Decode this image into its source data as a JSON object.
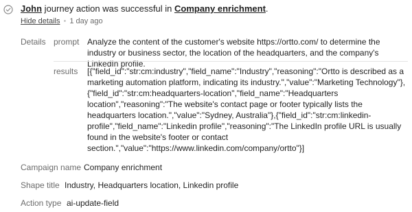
{
  "event": {
    "actor": "John",
    "message_mid": " journey action was successful in ",
    "journey": "Company enrichment",
    "message_end": ".",
    "hide_details": "Hide details",
    "time": "1 day ago"
  },
  "details": {
    "section_label": "Details",
    "prompt_label": "prompt",
    "prompt": "Analyze the content of the customer's website https://ortto.com/ to determine the industry or business sector, the location of the headquarters, and the company's LinkedIn profile.",
    "results_label": "results",
    "results": "[{\"field_id\":\"str:cm:industry\",\"field_name\":\"Industry\",\"reasoning\":\"Ortto is described as a marketing automation platform, indicating its industry.\",\"value\":\"Marketing Technology\"},{\"field_id\":\"str:cm:headquarters-location\",\"field_name\":\"Headquarters location\",\"reasoning\":\"The website's contact page or footer typically lists the headquarters location.\",\"value\":\"Sydney, Australia\"},{\"field_id\":\"str:cm:linkedin-profile\",\"field_name\":\"Linkedin profile\",\"reasoning\":\"The LinkedIn profile URL is usually found in the website's footer or contact section.\",\"value\":\"https://www.linkedin.com/company/ortto\"}]"
  },
  "fields": {
    "campaign_name_label": "Campaign name",
    "campaign_name": "Company enrichment",
    "shape_title_label": "Shape title",
    "shape_title": "Industry, Headquarters location, Linkedin profile",
    "action_type_label": "Action type",
    "action_type": "ai-update-field"
  },
  "icons": {
    "status": "check-circle-icon"
  },
  "colors": {
    "text": "#1f1f1f",
    "muted": "#6b6b6b",
    "divider": "#e4e4e4"
  }
}
